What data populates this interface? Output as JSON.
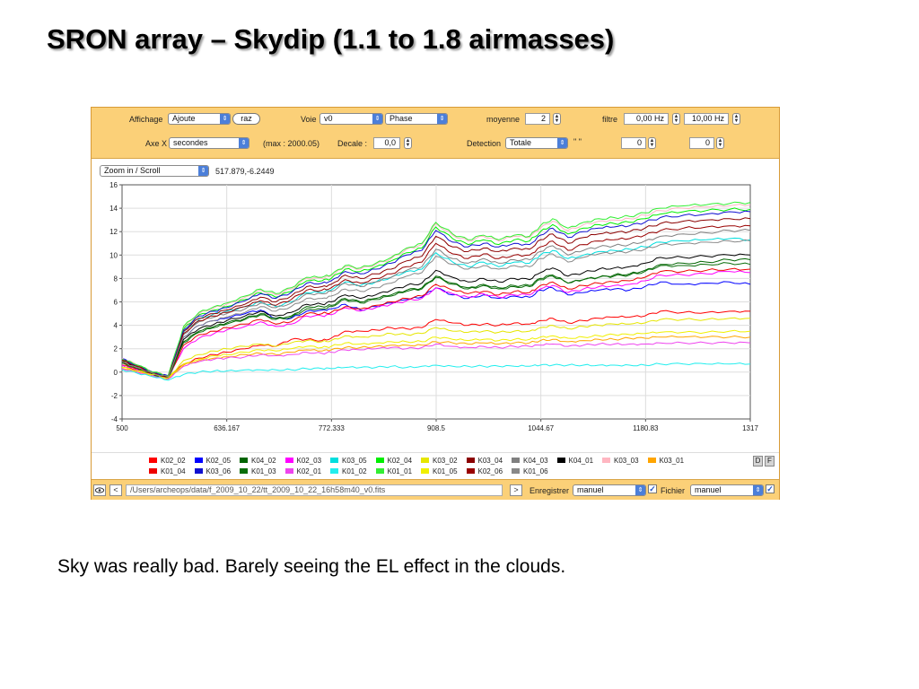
{
  "slide": {
    "title": "SRON array – Skydip (1.1 to 1.8 airmasses)",
    "caption": "Sky was really bad. Barely seeing the EL effect in the clouds."
  },
  "toolbar": {
    "affichage_label": "Affichage",
    "affichage_value": "Ajoute",
    "raz_label": "raz",
    "voie_label": "Voie",
    "voie_value": "v0",
    "mode_value": "Phase",
    "moyenne_label": "moyenne",
    "moyenne_value": "2",
    "filtre_label": "filtre",
    "filtre_low": "0,00 Hz",
    "filtre_high": "10,00 Hz",
    "axex_label": "Axe X",
    "axex_value": "secondes",
    "max_text": "(max : 2000.05)",
    "decale_label": "Decale :",
    "decale_value": "0,0",
    "detection_label": "Detection",
    "detection_value": "Totale",
    "quote_text": "\" \"",
    "field_a": "0",
    "field_b": "0"
  },
  "plot_header": {
    "zoom_mode": "Zoom in / Scroll",
    "cursor_readout": "517.879,-6.2449"
  },
  "chart_data": {
    "type": "line",
    "xlim": [
      500,
      1317
    ],
    "ylim": [
      -4,
      16
    ],
    "x_ticks": [
      "500",
      "636.167",
      "772.333",
      "908.5",
      "1044.67",
      "1180.83",
      "1317"
    ],
    "y_ticks": [
      "16",
      "14",
      "12",
      "10",
      "8",
      "6",
      "4",
      "2",
      "0",
      "-2",
      "-4"
    ],
    "grid": true,
    "legend_position": "bottom",
    "x": [
      500,
      520,
      540,
      560,
      580,
      600,
      620,
      636,
      660,
      680,
      700,
      720,
      740,
      760,
      772,
      790,
      810,
      830,
      850,
      870,
      890,
      908,
      930,
      950,
      970,
      990,
      1010,
      1030,
      1044,
      1060,
      1080,
      1100,
      1120,
      1140,
      1160,
      1180,
      1200,
      1230,
      1260,
      1290,
      1317
    ],
    "series": [
      {
        "name": "K02_02",
        "color": "#ff0000",
        "values": [
          0.6,
          0.2,
          -0.1,
          -0.4,
          0.7,
          1.2,
          1.5,
          1.7,
          2.0,
          2.3,
          2.2,
          2.8,
          2.8,
          2.7,
          2.9,
          3.5,
          3.5,
          3.6,
          3.8,
          3.7,
          3.8,
          4.5,
          4.2,
          4.0,
          4.1,
          4.0,
          4.2,
          4.1,
          4.4,
          4.6,
          4.2,
          4.4,
          4.6,
          4.7,
          4.7,
          4.8,
          5.2,
          5.1,
          5.1,
          5.2,
          5.2
        ]
      },
      {
        "name": "K02_05",
        "color": "#0000ff",
        "values": [
          1.2,
          0.5,
          0.0,
          -0.4,
          3.0,
          4.0,
          4.4,
          4.6,
          5.0,
          5.3,
          4.6,
          4.6,
          5.2,
          5.3,
          5.4,
          5.8,
          5.3,
          5.6,
          5.9,
          6.2,
          6.4,
          7.2,
          6.6,
          6.3,
          6.6,
          6.3,
          6.5,
          6.4,
          7.0,
          7.2,
          6.6,
          6.8,
          7.0,
          7.1,
          7.0,
          7.3,
          7.7,
          7.5,
          7.6,
          7.7,
          7.5
        ]
      },
      {
        "name": "K04_02",
        "color": "#006400",
        "values": [
          1.0,
          0.4,
          -0.1,
          -0.5,
          2.6,
          3.5,
          3.9,
          4.2,
          4.6,
          5.0,
          4.6,
          4.8,
          5.6,
          5.6,
          5.7,
          6.3,
          6.0,
          6.3,
          6.6,
          7.0,
          7.2,
          8.2,
          7.6,
          7.2,
          7.5,
          7.2,
          7.4,
          7.4,
          8.0,
          8.3,
          7.6,
          7.9,
          8.1,
          8.3,
          8.4,
          8.7,
          9.2,
          9.3,
          9.4,
          9.6,
          9.6
        ]
      },
      {
        "name": "K02_03",
        "color": "#ff00ff",
        "values": [
          0.6,
          0.2,
          -0.2,
          -0.5,
          2.0,
          2.9,
          3.3,
          3.6,
          3.9,
          4.3,
          3.9,
          4.1,
          4.8,
          4.8,
          4.9,
          5.5,
          5.2,
          5.5,
          5.8,
          6.1,
          6.3,
          7.2,
          6.7,
          6.4,
          6.7,
          6.4,
          6.6,
          6.6,
          7.1,
          7.4,
          6.8,
          7.1,
          7.3,
          7.4,
          7.5,
          7.8,
          8.3,
          8.3,
          8.4,
          8.6,
          8.5
        ]
      },
      {
        "name": "K03_05",
        "color": "#00dede",
        "values": [
          0.9,
          0.5,
          -0.1,
          -0.4,
          3.4,
          4.5,
          5.0,
          5.2,
          5.6,
          6.0,
          5.6,
          6.0,
          6.8,
          6.8,
          7.0,
          7.7,
          7.4,
          7.7,
          8.1,
          8.6,
          8.8,
          10.2,
          9.4,
          9.0,
          9.4,
          9.0,
          9.4,
          9.3,
          10.0,
          10.4,
          9.7,
          10.0,
          10.3,
          10.4,
          10.5,
          10.7,
          11.1,
          11.2,
          11.3,
          11.4,
          11.3
        ]
      },
      {
        "name": "K02_04",
        "color": "#00ee00",
        "values": [
          1.1,
          0.6,
          0.0,
          -0.3,
          3.7,
          4.9,
          5.3,
          5.6,
          6.2,
          6.8,
          6.4,
          6.9,
          7.8,
          7.8,
          8.0,
          8.8,
          8.6,
          9.0,
          9.5,
          10.2,
          10.6,
          12.4,
          11.4,
          10.9,
          11.3,
          10.9,
          11.3,
          11.2,
          12.0,
          12.6,
          11.8,
          12.3,
          12.6,
          12.7,
          12.8,
          13.1,
          13.5,
          13.7,
          13.8,
          13.9,
          13.9
        ]
      },
      {
        "name": "K03_02",
        "color": "#e6e600",
        "values": [
          0.4,
          0.1,
          -0.2,
          -0.5,
          1.0,
          1.5,
          1.8,
          2.0,
          2.2,
          2.4,
          2.2,
          2.5,
          2.7,
          2.6,
          2.7,
          3.1,
          3.0,
          3.1,
          3.3,
          3.2,
          3.3,
          3.8,
          3.5,
          3.4,
          3.5,
          3.4,
          3.5,
          3.5,
          3.8,
          4.0,
          3.7,
          3.9,
          4.0,
          4.1,
          4.1,
          4.2,
          4.5,
          4.5,
          4.5,
          4.6,
          4.6
        ]
      },
      {
        "name": "K03_04",
        "color": "#8b0000",
        "values": [
          1.0,
          0.5,
          -0.1,
          -0.4,
          3.5,
          4.6,
          5.0,
          5.3,
          5.8,
          6.4,
          6.0,
          6.5,
          7.3,
          7.3,
          7.5,
          8.3,
          8.0,
          8.4,
          8.8,
          9.5,
          9.9,
          11.6,
          10.7,
          10.3,
          10.6,
          10.3,
          10.6,
          10.5,
          11.3,
          11.8,
          11.0,
          11.5,
          11.8,
          11.9,
          12.0,
          12.3,
          12.7,
          12.9,
          13.0,
          13.1,
          13.1
        ]
      },
      {
        "name": "K04_03",
        "color": "#808080",
        "values": [
          0.9,
          0.5,
          -0.1,
          -0.4,
          3.2,
          4.3,
          4.7,
          5.0,
          5.4,
          5.9,
          5.5,
          5.9,
          6.7,
          6.7,
          6.9,
          7.6,
          7.3,
          7.7,
          8.1,
          8.7,
          9.0,
          10.5,
          9.7,
          9.3,
          9.7,
          9.3,
          9.6,
          9.6,
          10.3,
          10.8,
          10.0,
          10.4,
          10.7,
          10.8,
          10.9,
          11.2,
          11.6,
          11.8,
          11.9,
          12.1,
          12.1
        ]
      },
      {
        "name": "K04_01",
        "color": "#000000",
        "values": [
          0.9,
          0.4,
          -0.1,
          -0.5,
          2.8,
          3.7,
          4.1,
          4.4,
          4.8,
          5.2,
          4.8,
          5.1,
          5.8,
          5.8,
          6.0,
          6.6,
          6.3,
          6.6,
          7.0,
          7.4,
          7.6,
          8.7,
          8.1,
          7.7,
          8.0,
          7.7,
          8.0,
          7.9,
          8.5,
          8.9,
          8.2,
          8.5,
          8.8,
          8.9,
          9.0,
          9.3,
          9.8,
          9.8,
          9.9,
          10.0,
          10.0
        ]
      },
      {
        "name": "K03_03",
        "color": "#ffb6c1",
        "values": [
          1.2,
          0.6,
          0.0,
          -0.3,
          3.8,
          5.0,
          5.5,
          5.8,
          6.4,
          7.0,
          6.6,
          7.1,
          8.0,
          8.0,
          8.2,
          9.0,
          8.8,
          9.2,
          9.7,
          10.5,
          10.9,
          12.7,
          11.7,
          11.2,
          11.6,
          11.2,
          11.6,
          11.5,
          12.3,
          12.9,
          12.1,
          12.6,
          12.9,
          13.0,
          13.1,
          13.4,
          13.8,
          14.0,
          14.1,
          14.2,
          14.3
        ]
      },
      {
        "name": "K03_01",
        "color": "#ffa500",
        "values": [
          0.3,
          0.0,
          -0.3,
          -0.6,
          0.6,
          1.0,
          1.2,
          1.3,
          1.5,
          1.6,
          1.5,
          1.7,
          1.9,
          1.8,
          1.9,
          2.1,
          2.1,
          2.2,
          2.3,
          2.3,
          2.3,
          2.6,
          2.5,
          2.4,
          2.5,
          2.4,
          2.5,
          2.5,
          2.7,
          2.8,
          2.6,
          2.7,
          2.8,
          2.8,
          2.9,
          2.9,
          3.0,
          3.0,
          3.0,
          3.0,
          3.0
        ]
      },
      {
        "name": "K01_04",
        "color": "#ee0000",
        "values": [
          0.8,
          0.3,
          -0.1,
          -0.5,
          2.3,
          3.2,
          3.5,
          3.8,
          4.1,
          4.5,
          4.1,
          4.3,
          5.0,
          5.0,
          5.1,
          5.6,
          5.4,
          5.7,
          6.0,
          6.3,
          6.5,
          7.5,
          7.0,
          6.7,
          6.9,
          6.6,
          6.9,
          6.8,
          7.4,
          7.7,
          7.1,
          7.4,
          7.6,
          7.7,
          7.8,
          8.1,
          8.6,
          8.6,
          8.7,
          8.8,
          8.8
        ]
      },
      {
        "name": "K03_06",
        "color": "#1010d0",
        "values": [
          1.1,
          0.6,
          0.0,
          -0.3,
          3.6,
          4.8,
          5.2,
          5.5,
          6.1,
          6.7,
          6.3,
          6.8,
          7.6,
          7.6,
          7.8,
          8.6,
          8.4,
          8.8,
          9.3,
          10.0,
          10.4,
          12.1,
          11.1,
          10.7,
          11.0,
          10.7,
          11.0,
          10.9,
          11.7,
          12.3,
          11.5,
          12.0,
          12.3,
          12.4,
          12.5,
          12.8,
          13.2,
          13.4,
          13.5,
          13.7,
          13.7
        ]
      },
      {
        "name": "K01_03",
        "color": "#0a6e0a",
        "values": [
          0.8,
          0.3,
          -0.2,
          -0.5,
          2.5,
          3.4,
          3.8,
          4.1,
          4.5,
          4.9,
          4.5,
          4.7,
          5.4,
          5.4,
          5.6,
          6.2,
          5.9,
          6.2,
          6.5,
          6.9,
          7.1,
          8.1,
          7.5,
          7.1,
          7.4,
          7.1,
          7.3,
          7.3,
          7.9,
          8.2,
          7.6,
          7.9,
          8.1,
          8.2,
          8.3,
          8.6,
          9.1,
          9.1,
          9.2,
          9.3,
          9.2
        ]
      },
      {
        "name": "K02_01",
        "color": "#ee44ee",
        "values": [
          0.3,
          0.0,
          -0.3,
          -0.6,
          0.5,
          0.9,
          1.1,
          1.2,
          1.3,
          1.5,
          1.4,
          1.5,
          1.7,
          1.6,
          1.7,
          1.9,
          1.9,
          2.0,
          2.1,
          2.0,
          2.1,
          2.4,
          2.2,
          2.1,
          2.2,
          2.1,
          2.2,
          2.2,
          2.3,
          2.4,
          2.2,
          2.3,
          2.4,
          2.4,
          2.4,
          2.4,
          2.5,
          2.5,
          2.5,
          2.5,
          2.5
        ]
      },
      {
        "name": "K01_02",
        "color": "#22eeee",
        "values": [
          0.2,
          -0.1,
          -0.4,
          -0.7,
          -0.2,
          0.0,
          0.1,
          0.1,
          0.2,
          0.2,
          0.2,
          0.2,
          0.3,
          0.3,
          0.3,
          0.4,
          0.4,
          0.4,
          0.5,
          0.4,
          0.5,
          0.6,
          0.5,
          0.5,
          0.5,
          0.5,
          0.5,
          0.5,
          0.6,
          0.6,
          0.6,
          0.6,
          0.6,
          0.6,
          0.6,
          0.6,
          0.7,
          0.7,
          0.7,
          0.7,
          0.7
        ]
      },
      {
        "name": "K01_01",
        "color": "#33ee33",
        "values": [
          1.1,
          0.6,
          0.0,
          -0.3,
          3.9,
          5.1,
          5.6,
          5.9,
          6.5,
          7.1,
          6.7,
          7.2,
          8.1,
          8.1,
          8.3,
          9.1,
          8.9,
          9.3,
          9.8,
          10.6,
          11.0,
          12.8,
          11.8,
          11.3,
          11.7,
          11.3,
          11.7,
          11.6,
          12.5,
          13.1,
          12.3,
          12.8,
          13.1,
          13.2,
          13.3,
          13.6,
          14.0,
          14.2,
          14.3,
          14.4,
          14.5
        ]
      },
      {
        "name": "K01_05",
        "color": "#f0f000",
        "values": [
          0.4,
          0.1,
          -0.2,
          -0.5,
          0.7,
          1.1,
          1.4,
          1.5,
          1.7,
          1.9,
          1.8,
          2.0,
          2.2,
          2.1,
          2.2,
          2.5,
          2.4,
          2.5,
          2.6,
          2.6,
          2.6,
          3.0,
          2.8,
          2.7,
          2.8,
          2.7,
          2.8,
          2.8,
          3.0,
          3.1,
          2.9,
          3.0,
          3.1,
          3.2,
          3.2,
          3.3,
          3.4,
          3.4,
          3.4,
          3.5,
          3.5
        ]
      },
      {
        "name": "K02_06",
        "color": "#990000",
        "values": [
          1.0,
          0.5,
          -0.1,
          -0.4,
          3.3,
          4.4,
          4.8,
          5.1,
          5.6,
          6.1,
          5.7,
          6.2,
          7.0,
          7.0,
          7.2,
          7.9,
          7.6,
          8.0,
          8.4,
          9.0,
          9.4,
          11.0,
          10.1,
          9.7,
          10.1,
          9.7,
          10.0,
          10.0,
          10.7,
          11.2,
          10.4,
          10.9,
          11.2,
          11.3,
          11.4,
          11.7,
          12.1,
          12.3,
          12.4,
          12.5,
          12.5
        ]
      },
      {
        "name": "K01_06",
        "color": "#888888",
        "values": [
          0.9,
          0.4,
          -0.1,
          -0.4,
          3.0,
          4.0,
          4.4,
          4.7,
          5.1,
          5.6,
          5.2,
          5.6,
          6.3,
          6.3,
          6.5,
          7.1,
          6.9,
          7.2,
          7.6,
          8.2,
          8.5,
          9.9,
          9.2,
          8.8,
          9.1,
          8.8,
          9.1,
          9.0,
          9.7,
          10.1,
          9.4,
          9.8,
          10.1,
          10.2,
          10.3,
          10.5,
          10.9,
          11.0,
          11.1,
          11.2,
          11.2
        ]
      }
    ]
  },
  "legend_buttons": {
    "d": "D",
    "f": "F"
  },
  "statusbar": {
    "eye_icon": "eye-icon",
    "back_label": "<",
    "path": "/Users/archeops/data/f_2009_10_22/tt_2009_10_22_16h58m40_v0.fits",
    "forward_label": ">",
    "enregistrer_label": "Enregistrer",
    "enregistrer_value": "manuel",
    "fichier_label": "Fichier",
    "fichier_value": "manuel",
    "check_mark": "✓"
  }
}
